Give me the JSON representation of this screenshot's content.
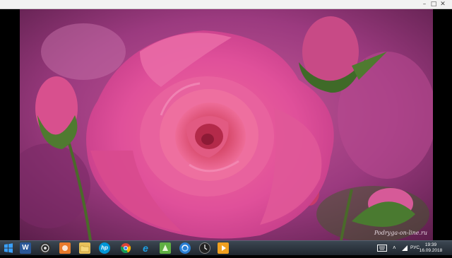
{
  "window": {
    "minimize_glyph": "–",
    "maximize_glyph": "□",
    "close_glyph": "✕"
  },
  "photo": {
    "subject_icon": "rose-photo",
    "watermark": "Podryga-on-line.ru"
  },
  "taskbar": {
    "icons": [
      {
        "name": "start-button-icon",
        "color": "#1e90ff"
      },
      {
        "name": "word-icon",
        "color": "#2b5797",
        "glyph": "W"
      },
      {
        "name": "camera-icon",
        "color": "#333333"
      },
      {
        "name": "paint-icon",
        "color": "#e87a2b"
      },
      {
        "name": "folder-icon",
        "color": "#e8c15a"
      },
      {
        "name": "hp-icon",
        "color": "#0096d6",
        "glyph": "hp"
      },
      {
        "name": "chrome-icon",
        "color": "#db4437"
      },
      {
        "name": "ie-icon",
        "color": "#1ea0e6",
        "glyph": "e"
      },
      {
        "name": "green-app-icon",
        "color": "#5fb043"
      },
      {
        "name": "sync-icon",
        "color": "#2a7fd4"
      },
      {
        "name": "media-player-icon",
        "color": "#222222"
      },
      {
        "name": "video-icon",
        "color": "#f0a020"
      }
    ],
    "tray": {
      "keyboard_icon": "keyboard-icon",
      "language": "РУС"
    },
    "clock": {
      "time": "19:39",
      "date": "16.09.2018"
    }
  }
}
